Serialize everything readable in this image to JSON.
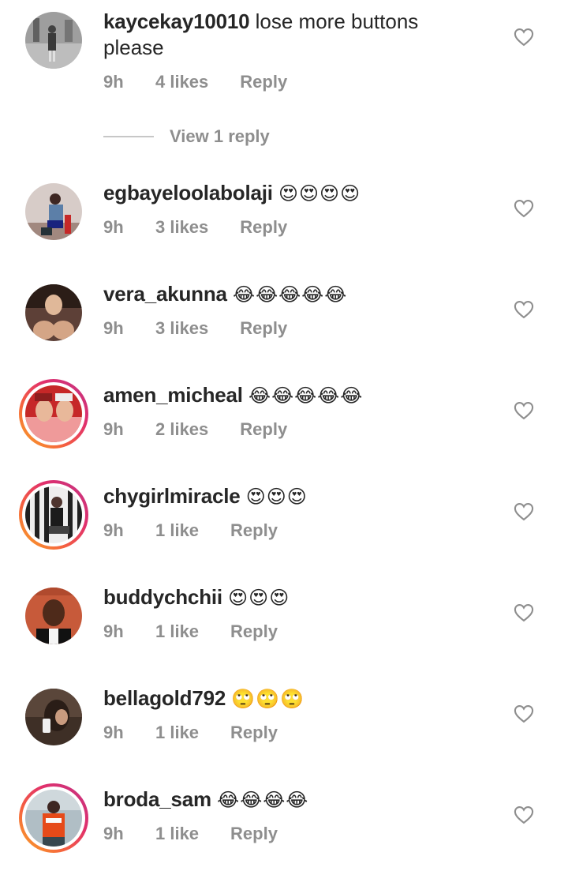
{
  "comments": [
    {
      "username": "kaycekay10010",
      "text": "lose more buttons please",
      "time": "9h",
      "likes": "4 likes",
      "reply": "Reply"
    },
    {
      "username": "egbayeloolabolaji",
      "text": "😍😍😍😍",
      "time": "9h",
      "likes": "3 likes",
      "reply": "Reply"
    },
    {
      "username": "vera_akunna",
      "text": "😂😂😂😂😂",
      "time": "9h",
      "likes": "3 likes",
      "reply": "Reply"
    },
    {
      "username": "amen_micheal",
      "text": "😂😂😂😂😂",
      "time": "9h",
      "likes": "2 likes",
      "reply": "Reply"
    },
    {
      "username": "chygirlmiracle",
      "text": "😍😍😍",
      "time": "9h",
      "likes": "1 like",
      "reply": "Reply"
    },
    {
      "username": "buddychchii",
      "text": "😍😍😍",
      "time": "9h",
      "likes": "1 like",
      "reply": "Reply"
    },
    {
      "username": "bellagold792",
      "text": "🙄🙄🙄",
      "time": "9h",
      "likes": "1 like",
      "reply": "Reply"
    },
    {
      "username": "broda_sam",
      "text": "😂😂😂😂",
      "time": "9h",
      "likes": "1 like",
      "reply": "Reply"
    }
  ],
  "view_replies": "View 1 reply",
  "icons": {
    "like": "heart-outline-icon"
  },
  "colors": {
    "secondary_text": "#8e8e8e",
    "primary_text": "#262626",
    "story_ring": "#e1306c"
  }
}
